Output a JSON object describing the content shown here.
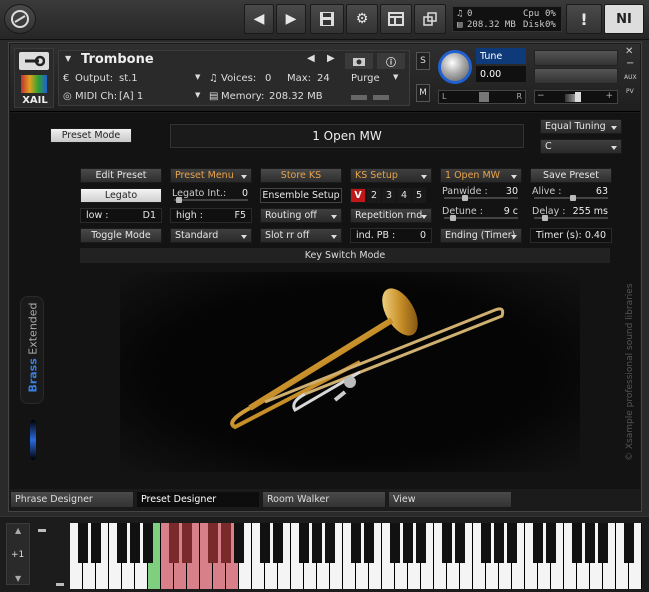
{
  "topbar": {
    "cpu_label": "Cpu",
    "cpu_value": "0%",
    "disk_label": "Disk",
    "disk_value": "0%",
    "voices_value": "0",
    "memory_value": "208.32 MB",
    "warning": "!",
    "ni_logo": "NI"
  },
  "instrument": {
    "name": "Trombone",
    "output_label": "Output:",
    "output_value": "st.1",
    "midi_label": "MIDI Ch:",
    "midi_value": "[A] 1",
    "voices_label": "Voices:",
    "voices_value": "0",
    "max_label": "Max:",
    "max_value": "24",
    "memory_label": "Memory:",
    "memory_value": "208.32 MB",
    "purge_label": "Purge",
    "s_label": "S",
    "m_label": "M",
    "tune_label": "Tune",
    "tune_value": "0.00",
    "pan_left": "L",
    "pan_right": "R",
    "aux_label": "AUX",
    "pv_label": "PV",
    "logo_text": "XAIL"
  },
  "preset": {
    "mode_button": "Preset Mode",
    "name_display": "1 Open MW",
    "tuning": "Equal Tuning",
    "key": "C"
  },
  "controls": {
    "edit_preset": "Edit Preset",
    "preset_menu": "Preset Menu",
    "store_ks": "Store KS",
    "ks_setup": "KS Setup",
    "art_select": "1 Open MW",
    "save_preset": "Save Preset",
    "legato": "Legato",
    "legato_int_label": "Legato Int.:",
    "legato_int_value": "0",
    "ensemble_setup": "Ensemble Setup",
    "ks_v": "V",
    "ks_2": "2",
    "ks_3": "3",
    "ks_4": "4",
    "ks_5": "5",
    "panwide_label": "Panwide :",
    "panwide_value": "30",
    "alive_label": "Alive :",
    "alive_value": "63",
    "low_label": "low :",
    "low_value": "D1",
    "high_label": "high :",
    "high_value": "F5",
    "routing": "Routing off",
    "repetition": "Repetition rnd",
    "detune_label": "Detune :",
    "detune_value": "9 c",
    "delay_label": "Delay :",
    "delay_value": "255 ms",
    "toggle_mode": "Toggle Mode",
    "standard": "Standard",
    "slot_rr": "Slot rr off",
    "ind_pb_label": "ind. PB :",
    "ind_pb_value": "0",
    "ending": "Ending (Timer)",
    "timer_label": "Timer (s):",
    "timer_value": "0.40",
    "ks_mode_bar": "Key Switch Mode"
  },
  "side": {
    "brass": "Brass",
    "extended": "Extended",
    "copyright": "© Xsample professional sound libraries"
  },
  "tabs": [
    "Phrase Designer",
    "Preset Designer",
    "Room Walker",
    "View"
  ],
  "keyboard": {
    "octave_label": "+1"
  },
  "colors": {
    "accent_orange": "#e8a24a",
    "ks_red": "#d8808a",
    "ks_green": "#7ed07e",
    "brand_blue": "#1e6ad0"
  }
}
